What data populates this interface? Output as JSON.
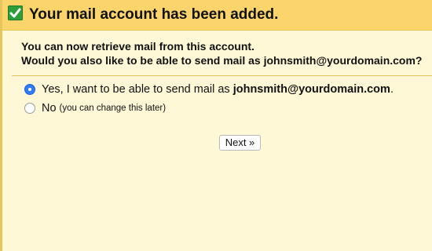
{
  "header": {
    "icon": "checkmark-icon",
    "title": "Your mail account has been added."
  },
  "intro": {
    "line1": "You can now retrieve mail from this account.",
    "line2": "Would you also like to be able to send mail as johnsmith@yourdomain.com?"
  },
  "options": {
    "yes": {
      "selected": true,
      "text": "Yes, I want to be able to send mail as ",
      "email": "johnsmith@yourdomain.com",
      "suffix": "."
    },
    "no": {
      "selected": false,
      "text": "No",
      "note": "(you can change this later)"
    }
  },
  "actions": {
    "next_label": "Next »"
  },
  "colors": {
    "header_bg": "#fbd56c",
    "panel_bg": "#fff8d6",
    "check_green": "#2e9e3b",
    "radio_blue": "#2f7cf6"
  }
}
